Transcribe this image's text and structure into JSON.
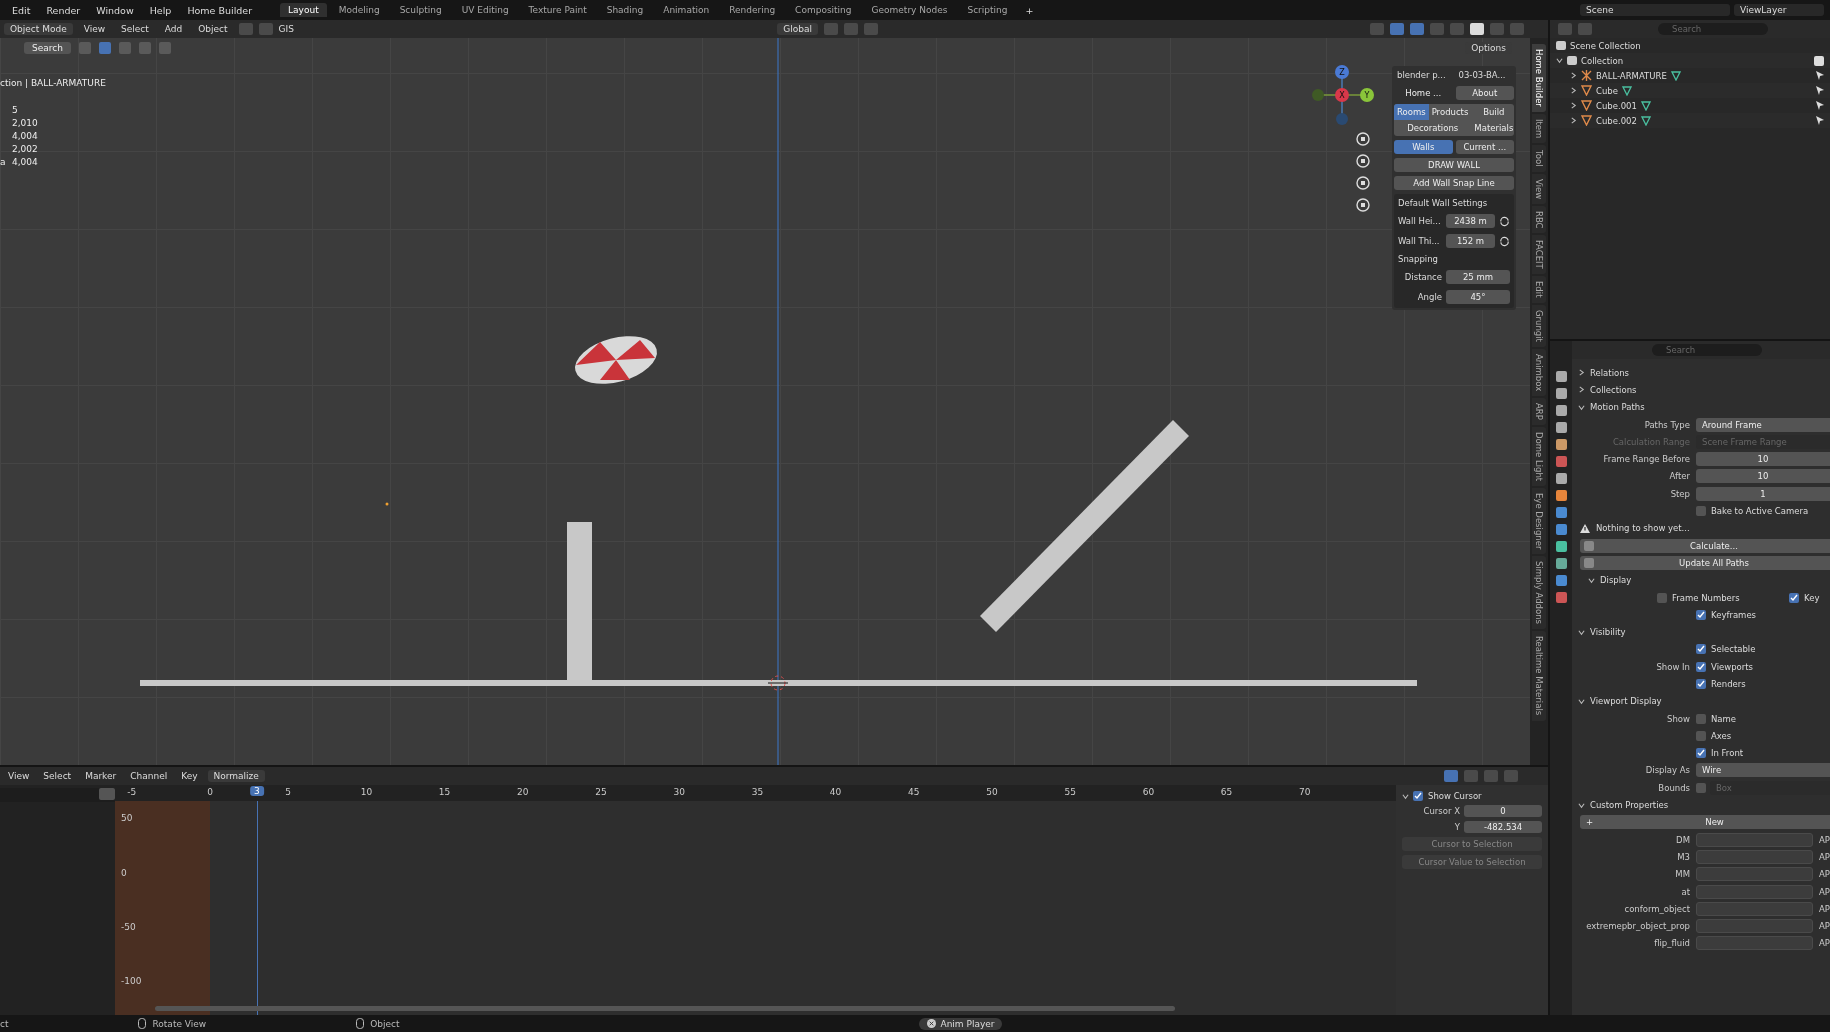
{
  "menu": [
    "Edit",
    "Render",
    "Window",
    "Help",
    "Home Builder"
  ],
  "workspaces": [
    {
      "label": "Layout",
      "selected": true
    },
    {
      "label": "Modeling",
      "selected": false
    },
    {
      "label": "Sculpting",
      "selected": false
    },
    {
      "label": "UV Editing",
      "selected": false
    },
    {
      "label": "Texture Paint",
      "selected": false
    },
    {
      "label": "Shading",
      "selected": false
    },
    {
      "label": "Animation",
      "selected": false
    },
    {
      "label": "Rendering",
      "selected": false
    },
    {
      "label": "Compositing",
      "selected": false
    },
    {
      "label": "Geometry Nodes",
      "selected": false
    },
    {
      "label": "Scripting",
      "selected": false
    }
  ],
  "add_workspace": "+",
  "scene": "Scene",
  "view_layer": "ViewLayer",
  "viewport": {
    "mode": "Object Mode",
    "menus": [
      "View",
      "Select",
      "Add",
      "Object"
    ],
    "gis": "GIS",
    "orientation": "Global",
    "options": "Options",
    "search": "Search",
    "overlay_title": "ction | BALL-ARMATURE",
    "stats": [
      {
        "value": "5"
      },
      {
        "value": "2,010"
      },
      {
        "value": "4,004"
      },
      {
        "value": "2,002"
      },
      {
        "label": "a",
        "value": "4,004"
      }
    ],
    "gizmo_axes": [
      "Z",
      "X",
      "Y"
    ]
  },
  "addon_panel": {
    "dropdowns": [
      "blender p...",
      "03-03-BA..."
    ],
    "home": "Home ...",
    "about": "About",
    "categories": [
      {
        "label": "Rooms",
        "selected": true
      },
      {
        "label": "Products",
        "selected": false
      },
      {
        "label": "Build",
        "selected": false
      },
      {
        "label": "Decorations",
        "selected": false
      },
      {
        "label": "Materials",
        "selected": false
      }
    ],
    "modes": [
      {
        "label": "Walls",
        "selected": true
      },
      {
        "label": "Current ...",
        "selected": false
      }
    ],
    "draw_wall": "DRAW WALL",
    "snap_line": "Add Wall Snap Line",
    "settings_title": "Default Wall Settings",
    "settings": [
      {
        "label": "Wall Hei...",
        "value": "2438 m",
        "reset": true
      },
      {
        "label": "Wall Thi...",
        "value": "152 m",
        "reset": true
      }
    ],
    "snapping_title": "Snapping",
    "snapping": [
      {
        "label": "Distance",
        "value": "25 mm"
      },
      {
        "label": "Angle",
        "value": "45°"
      }
    ]
  },
  "sidebar_tabs": [
    {
      "label": "Home Builder",
      "selected": true
    },
    {
      "label": "Item",
      "selected": false
    },
    {
      "label": "Tool",
      "selected": false
    },
    {
      "label": "View",
      "selected": false
    },
    {
      "label": "RBC",
      "selected": false
    },
    {
      "label": "FACEIT",
      "selected": false
    },
    {
      "label": "Edit",
      "selected": false
    },
    {
      "label": "Grungit",
      "selected": false
    },
    {
      "label": "Animbox",
      "selected": false
    },
    {
      "label": "ARP",
      "selected": false
    },
    {
      "label": "Dome Light",
      "selected": false
    },
    {
      "label": "Eye Designer",
      "selected": false
    },
    {
      "label": "Simply Addons",
      "selected": false
    },
    {
      "label": "Realtime Materials",
      "selected": false
    }
  ],
  "outliner": {
    "search_placeholder": "Search",
    "root": "Scene Collection",
    "collection": {
      "label": "Collection",
      "checked": true,
      "children": [
        {
          "label": "BALL-ARMATURE",
          "kind": "armature"
        },
        {
          "label": "Cube",
          "kind": "mesh"
        },
        {
          "label": "Cube.001",
          "kind": "mesh"
        },
        {
          "label": "Cube.002",
          "kind": "mesh"
        }
      ]
    }
  },
  "properties": {
    "search_placeholder": "Search",
    "rows": [
      {
        "kind": "section",
        "label": "Relations",
        "expanded": false,
        "sub": false
      },
      {
        "kind": "section",
        "label": "Collections",
        "expanded": false,
        "sub": false
      },
      {
        "kind": "section",
        "label": "Motion Paths",
        "expanded": true,
        "sub": false
      },
      {
        "kind": "field",
        "label": "Paths Type",
        "value": "Around Frame",
        "disabled": false,
        "centered": false
      },
      {
        "kind": "field",
        "label": "Calculation Range",
        "value": "Scene Frame Range",
        "disabled": true,
        "centered": false
      },
      {
        "kind": "field",
        "label": "Frame Range Before",
        "value": "10",
        "disabled": false,
        "centered": true
      },
      {
        "kind": "field",
        "label": "After",
        "value": "10",
        "disabled": false,
        "centered": true
      },
      {
        "kind": "field",
        "label": "Step",
        "value": "1",
        "disabled": false,
        "centered": true
      },
      {
        "kind": "check",
        "checks": [
          {
            "text": "Bake to Active Camera",
            "checked": false
          }
        ]
      },
      {
        "kind": "warning",
        "text": "Nothing to show yet..."
      },
      {
        "kind": "button",
        "text": "Calculate..."
      },
      {
        "kind": "button",
        "text": "Update All Paths"
      },
      {
        "kind": "section",
        "label": "Display",
        "expanded": true,
        "sub": true
      },
      {
        "kind": "check",
        "checks": [
          {
            "text": "Frame Numbers",
            "checked": false
          },
          {
            "text": "Key",
            "checked": true
          }
        ]
      },
      {
        "kind": "check",
        "checks": [
          {
            "text": "Keyframes",
            "checked": true
          }
        ]
      },
      {
        "kind": "section",
        "label": "Visibility",
        "expanded": true,
        "sub": false
      },
      {
        "kind": "check",
        "checks": [
          {
            "text": "Selectable",
            "checked": true
          }
        ]
      },
      {
        "kind": "check",
        "label": "Show In",
        "checks": [
          {
            "text": "Viewports",
            "checked": true
          }
        ]
      },
      {
        "kind": "check",
        "checks": [
          {
            "text": "Renders",
            "checked": true
          }
        ]
      },
      {
        "kind": "section",
        "label": "Viewport Display",
        "expanded": true,
        "sub": false
      },
      {
        "kind": "check",
        "label": "Show",
        "checks": [
          {
            "text": "Name",
            "checked": false
          }
        ]
      },
      {
        "kind": "check",
        "checks": [
          {
            "text": "Axes",
            "checked": false
          }
        ]
      },
      {
        "kind": "check",
        "checks": [
          {
            "text": "In Front",
            "checked": true
          }
        ]
      },
      {
        "kind": "field",
        "label": "Display As",
        "value": "Wire",
        "disabled": false,
        "centered": false
      },
      {
        "kind": "checkfield",
        "label": "Bounds",
        "checked": false,
        "value": "Box"
      },
      {
        "kind": "section",
        "label": "Custom Properties",
        "expanded": true,
        "sub": false
      },
      {
        "kind": "button",
        "text": "New",
        "plus": "+"
      },
      {
        "kind": "custom",
        "label": "DM",
        "suffix": "AP"
      },
      {
        "kind": "custom",
        "label": "M3",
        "suffix": "AP"
      },
      {
        "kind": "custom",
        "label": "MM",
        "suffix": "AP"
      },
      {
        "kind": "custom",
        "label": "at",
        "suffix": "AP"
      },
      {
        "kind": "custom",
        "label": "conform_object",
        "suffix": "AP"
      },
      {
        "kind": "custom",
        "label": "extremepbr_object_prop",
        "suffix": "AP"
      },
      {
        "kind": "custom",
        "label": "flip_fluid",
        "suffix": "AP"
      }
    ]
  },
  "graph_editor": {
    "menus": [
      "View",
      "Select",
      "Marker",
      "Channel",
      "Key"
    ],
    "normalize": "Normalize",
    "frames": [
      "-5",
      "0",
      "5",
      "10",
      "15",
      "20",
      "25",
      "30",
      "35",
      "40",
      "45",
      "50",
      "55",
      "60",
      "65",
      "70"
    ],
    "current_frame": "3",
    "values": [
      "50",
      "0",
      "-50",
      "-100"
    ],
    "show_cursor": {
      "label": "Show Cursor",
      "checked": true
    },
    "cursor_fields": [
      {
        "label": "Cursor X",
        "value": "0"
      },
      {
        "label": "Y",
        "value": "-482.534"
      }
    ],
    "buttons": [
      "Cursor to Selection",
      "Cursor Value to Selection"
    ]
  },
  "status_bar": {
    "left": "ct",
    "items": [
      "Rotate View",
      "Object"
    ],
    "player": "Anim Player"
  }
}
